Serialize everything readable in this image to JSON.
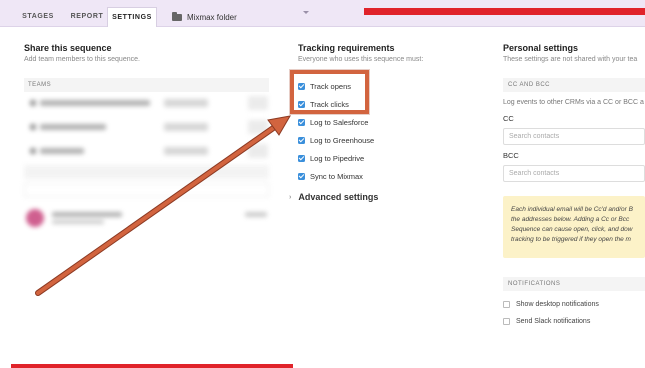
{
  "tabs": {
    "stages": "STAGES",
    "report": "REPORT",
    "settings": "SETTINGS",
    "folder": "Mixmax folder"
  },
  "share": {
    "title": "Share this sequence",
    "subtitle": "Add team members to this sequence.",
    "teams_header": "TEAMS"
  },
  "tracking": {
    "title": "Tracking requirements",
    "subtitle": "Everyone who uses this sequence must:",
    "items": [
      {
        "label": "Track opens",
        "checked": true
      },
      {
        "label": "Track clicks",
        "checked": true
      },
      {
        "label": "Log to Salesforce",
        "checked": true
      },
      {
        "label": "Log to Greenhouse",
        "checked": true
      },
      {
        "label": "Log to Pipedrive",
        "checked": true
      },
      {
        "label": "Sync to Mixmax",
        "checked": true
      }
    ],
    "advanced": "Advanced settings"
  },
  "personal": {
    "title": "Personal settings",
    "subtitle": "These settings are not shared with your tea",
    "cc_bcc_header": "CC AND BCC",
    "cc_bcc_desc": "Log events to other CRMs via a CC or BCC a",
    "cc_label": "CC",
    "cc_placeholder": "Search contacts",
    "bcc_label": "BCC",
    "bcc_placeholder": "Search contacts",
    "warning_lines": [
      "Each individual email will be Cc'd and/or B",
      "the addresses below. Adding a Cc or Bcc",
      "Sequence can cause open, click, and dow",
      "tracking to be triggered if they open the m"
    ],
    "notifications_header": "NOTIFICATIONS",
    "notif_desktop": "Show desktop notifications",
    "notif_slack": "Send Slack notifications"
  },
  "colors": {
    "tab_bar": "#efe7f6",
    "checkbox": "#3a8fdb",
    "highlight": "#d2643f",
    "red_bar": "#e0232a",
    "warning_bg": "#fcf2c8"
  }
}
